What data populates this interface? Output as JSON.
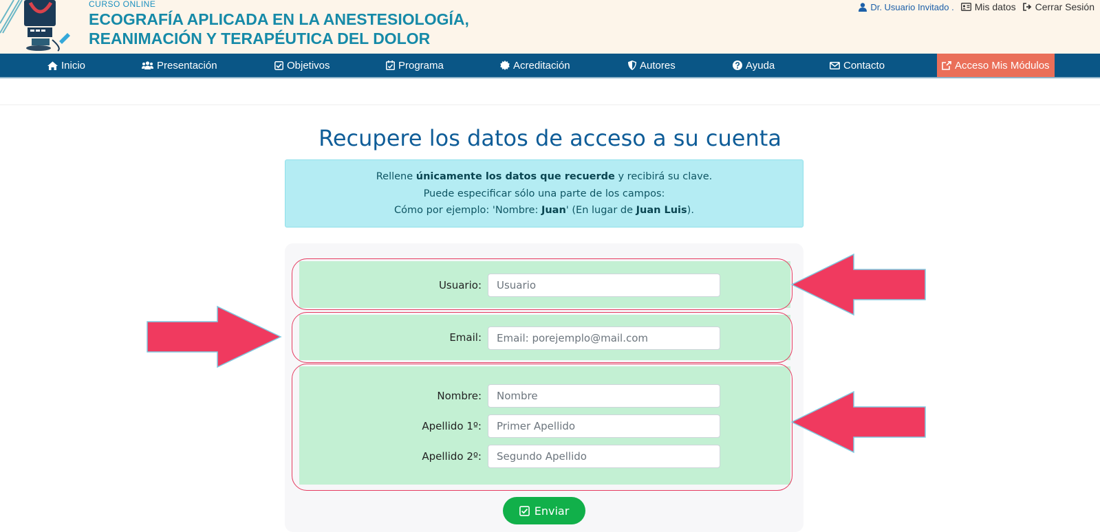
{
  "header": {
    "kicker": "CURSO  ONLINE",
    "title_line1": "ECOGRAFÍA APLICADA EN LA ANESTESIOLOGÍA,",
    "title_line2": "REANIMACIÓN Y TERAPÉUTICA DEL DOLOR",
    "user_name": "Dr. Usuario Invitado .",
    "my_data": "Mis datos",
    "logout": "Cerrar Sesión"
  },
  "nav": {
    "items": [
      {
        "label": "Inicio",
        "icon": "home-icon"
      },
      {
        "label": "Presentación",
        "icon": "users-icon"
      },
      {
        "label": "Objetivos",
        "icon": "check-square-icon"
      },
      {
        "label": "Programa",
        "icon": "calendar-check-icon"
      },
      {
        "label": "Acreditación",
        "icon": "certificate-icon"
      },
      {
        "label": "Autores",
        "icon": "shield-icon"
      },
      {
        "label": "Ayuda",
        "icon": "question-circle-icon"
      },
      {
        "label": "Contacto",
        "icon": "envelope-icon"
      }
    ],
    "access": {
      "label": "Acceso Mis Módulos",
      "icon": "external-link-icon"
    }
  },
  "page": {
    "title": "Recupere los datos de acceso a su cuenta"
  },
  "info": {
    "l1_pre": "Rellene ",
    "l1_bold": "únicamente los datos que recuerde",
    "l1_post": " y recibirá su clave.",
    "l2": "Puede especificar sólo una parte de los campos:",
    "l3_pre": "Cómo por ejemplo: 'Nombre: ",
    "l3_b1": "Juan",
    "l3_mid": "' (En lugar de ",
    "l3_b2": "Juan Luis",
    "l3_post": ")."
  },
  "form": {
    "usuario": {
      "label": "Usuario:",
      "placeholder": "Usuario"
    },
    "email": {
      "label": "Email:",
      "placeholder": "Email: porejemplo@mail.com"
    },
    "nombre": {
      "label": "Nombre:",
      "placeholder": "Nombre"
    },
    "apellido1": {
      "label": "Apellido 1º:",
      "placeholder": "Primer Apellido"
    },
    "apellido2": {
      "label": "Apellido 2º:",
      "placeholder": "Segundo Apellido"
    },
    "submit": "Enviar"
  },
  "colors": {
    "nav_bg": "#0a5686",
    "access_bg": "#ea6f59",
    "title": "#0f5d98",
    "info_bg": "#b4ecf3",
    "section_bg": "#c3f0d3",
    "arrow": "#f03a5f",
    "submit_bg": "#11b04a"
  }
}
